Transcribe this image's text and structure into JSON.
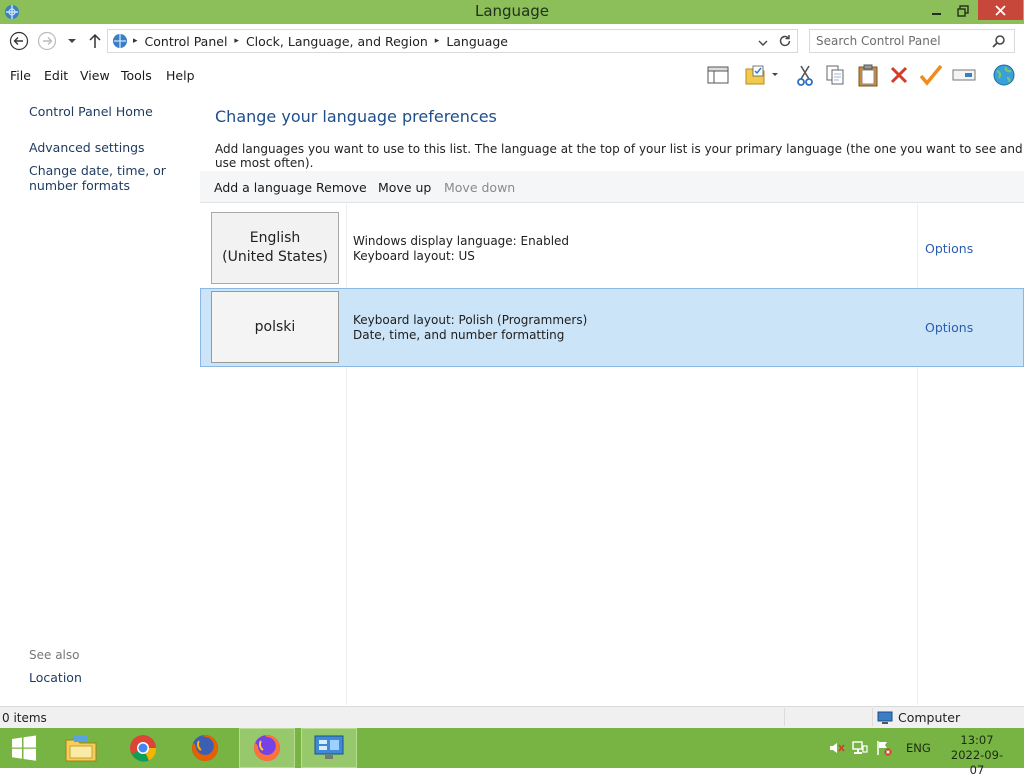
{
  "window": {
    "title": "Language"
  },
  "address": {
    "crumbs": [
      "Control Panel",
      "Clock, Language, and Region",
      "Language"
    ],
    "search_placeholder": "Search Control Panel"
  },
  "menu": {
    "items": [
      "File",
      "Edit",
      "View",
      "Tools",
      "Help"
    ]
  },
  "left_nav": {
    "home": "Control Panel Home",
    "advanced": "Advanced settings",
    "date_formats": "Change date, time, or number formats",
    "see_also": "See also",
    "location": "Location"
  },
  "content": {
    "title": "Change your language preferences",
    "description": "Add languages you want to use to this list. The language at the top of your list is your primary language (the one you want to see and use most often)."
  },
  "commands": {
    "add": "Add a language",
    "remove": "Remove",
    "move_up": "Move up",
    "move_down": "Move down"
  },
  "languages": [
    {
      "name": "English (United States)",
      "line1": "Windows display language: Enabled",
      "line2": "Keyboard layout: US",
      "options": "Options",
      "selected": false
    },
    {
      "name": "polski",
      "line1": "Keyboard layout: Polish (Programmers)",
      "line2": "Date, time, and number formatting",
      "options": "Options",
      "selected": true
    }
  ],
  "status": {
    "items": "0 items",
    "location": "Computer"
  },
  "taskbar": {
    "apps": [
      "file-explorer-icon",
      "chrome-icon",
      "firefox-icon",
      "firefox-icon",
      "control-panel-icon"
    ],
    "lang": "ENG",
    "time": "13:07",
    "date": "2022-09-07"
  },
  "colors": {
    "titlebar": "#8cbf5a",
    "taskbar": "#78b444",
    "close": "#c7483a",
    "link": "#2a5db0",
    "heading": "#1e4e8c",
    "selection": "#cce4f7"
  }
}
